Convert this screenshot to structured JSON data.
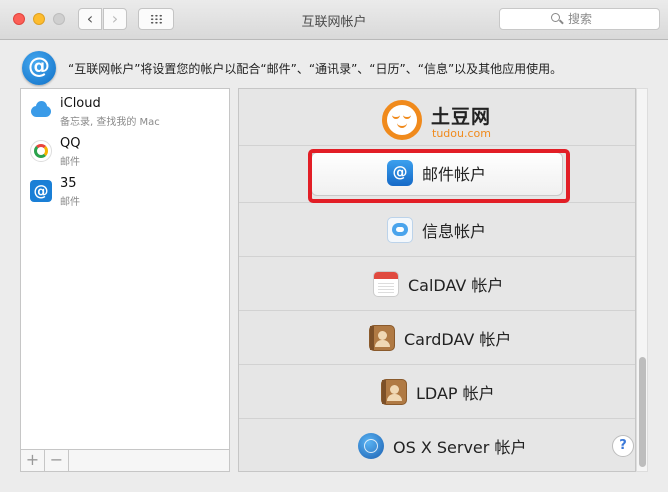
{
  "window": {
    "title": "互联网帐户",
    "search_placeholder": "搜索"
  },
  "toolbar": {
    "back_icon": "chevron-left-icon",
    "forward_icon": "chevron-right-icon",
    "grid_icon": "grid-icon"
  },
  "info": {
    "text": "“互联网帐户”将设置您的帐户以配合“邮件”、“通讯录”、“日历”、“信息”以及其他应用使用。"
  },
  "accounts": [
    {
      "name": "iCloud",
      "subtitle": "备忘录, 查找我的 Mac",
      "icon": "icloud-icon"
    },
    {
      "name": "QQ",
      "subtitle": "邮件",
      "icon": "qq-icon"
    },
    {
      "name": "35",
      "subtitle": "邮件",
      "icon": "at-mail-icon"
    }
  ],
  "list_footer": {
    "add_label": "+",
    "remove_label": "−"
  },
  "providers": {
    "tudou": {
      "brand": "土豆网",
      "domain": "tudou.com"
    },
    "items": [
      {
        "label": "邮件帐户",
        "icon": "mail-at-icon",
        "selected": true
      },
      {
        "label": "信息帐户",
        "icon": "messages-icon"
      },
      {
        "label": "CalDAV 帐户",
        "icon": "calendar-icon"
      },
      {
        "label": "CardDAV 帐户",
        "icon": "contacts-book-icon"
      },
      {
        "label": "LDAP 帐户",
        "icon": "contacts-book-icon"
      },
      {
        "label": "OS X Server 帐户",
        "icon": "server-globe-icon"
      }
    ]
  },
  "help": {
    "label": "?"
  },
  "colors": {
    "highlight": "#e21e26",
    "tudou_orange": "#f08a1c",
    "accent_blue": "#1a7fd6"
  }
}
